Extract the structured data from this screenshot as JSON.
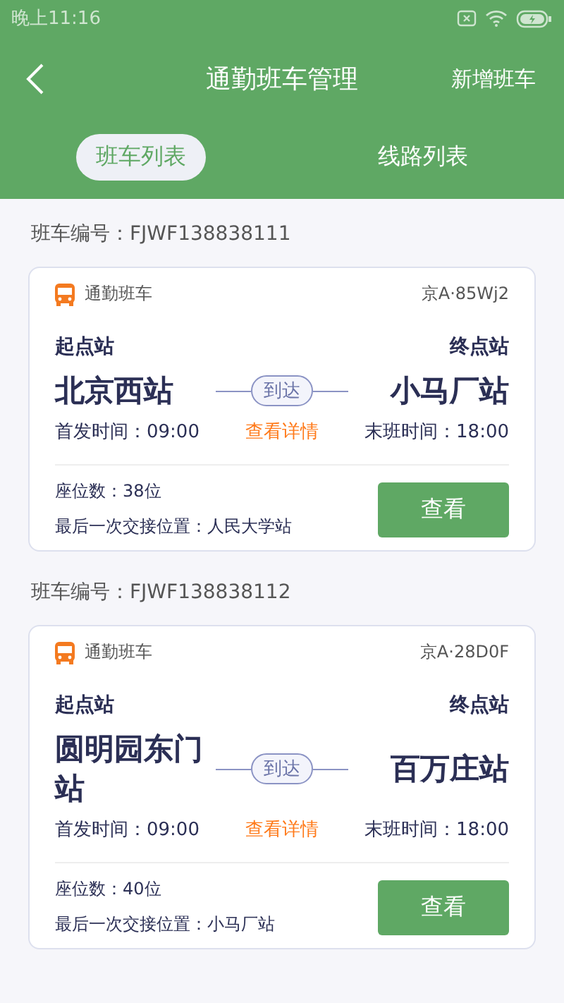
{
  "status_bar": {
    "time": "晚上11:16"
  },
  "header": {
    "title": "通勤班车管理",
    "action": "新增班车"
  },
  "tabs": [
    {
      "label": "班车列表",
      "selected": true
    },
    {
      "label": "线路列表",
      "selected": false
    }
  ],
  "buses": [
    {
      "number_label": "班车编号：FJWF138838111",
      "type": "通勤班车",
      "plate": "京A·85Wj2",
      "start_label": "起点站",
      "end_label": "终点站",
      "start": "北京西站",
      "end": "小马厂站",
      "arrive": "到达",
      "first_time": "首发时间：09:00",
      "details": "查看详情",
      "last_time": "末班时间：18:00",
      "seats": "座位数：38位",
      "last_handover": "最后一次交接位置：人民大学站",
      "button": "查看"
    },
    {
      "number_label": "班车编号：FJWF138838112",
      "type": "通勤班车",
      "plate": "京A·28D0F",
      "start_label": "起点站",
      "end_label": "终点站",
      "start": "圆明园东门站",
      "end": "百万庄站",
      "arrive": "到达",
      "first_time": "首发时间：09:00",
      "details": "查看详情",
      "last_time": "末班时间：18:00",
      "seats": "座位数：40位",
      "last_handover": "最后一次交接位置：小马厂站",
      "button": "查看"
    }
  ]
}
